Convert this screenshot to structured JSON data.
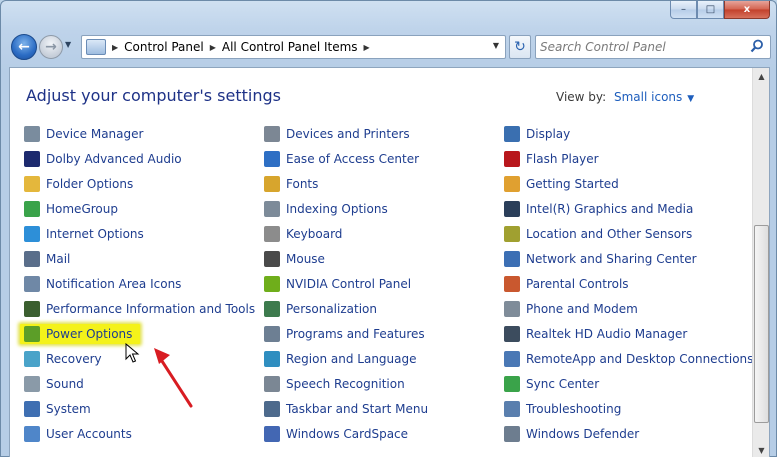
{
  "window": {
    "minimize_label": "–",
    "maximize_label": "□",
    "close_label": "x"
  },
  "nav": {
    "back_glyph": "←",
    "forward_glyph": "→",
    "refresh_glyph": "↻"
  },
  "address": {
    "crumbs": [
      "Control Panel",
      "All Control Panel Items"
    ]
  },
  "search": {
    "placeholder": "Search Control Panel"
  },
  "header": {
    "title": "Adjust your computer's settings",
    "view_by_label": "View by:",
    "view_mode": "Small icons"
  },
  "items": {
    "col1": [
      {
        "label": "Device Manager",
        "icon": "device-manager-icon",
        "color": "#7a8c9e"
      },
      {
        "label": "Dolby Advanced Audio",
        "icon": "dolby-icon",
        "color": "#1d2a6e"
      },
      {
        "label": "Folder Options",
        "icon": "folder-icon",
        "color": "#e4b73c"
      },
      {
        "label": "HomeGroup",
        "icon": "homegroup-icon",
        "color": "#3aa34a"
      },
      {
        "label": "Internet Options",
        "icon": "internet-icon",
        "color": "#2d8fd8"
      },
      {
        "label": "Mail",
        "icon": "mail-icon",
        "color": "#5a6e8a"
      },
      {
        "label": "Notification Area Icons",
        "icon": "notification-icon",
        "color": "#6f88a6"
      },
      {
        "label": "Performance Information and Tools",
        "icon": "performance-icon",
        "color": "#3b5f2f"
      },
      {
        "label": "Power Options",
        "icon": "power-icon",
        "color": "#5c9e28"
      },
      {
        "label": "Recovery",
        "icon": "recovery-icon",
        "color": "#4aa3c9"
      },
      {
        "label": "Sound",
        "icon": "sound-icon",
        "color": "#8a9aa8"
      },
      {
        "label": "System",
        "icon": "system-icon",
        "color": "#3f6fb2"
      },
      {
        "label": "User Accounts",
        "icon": "user-accounts-icon",
        "color": "#4f86c9"
      }
    ],
    "col2": [
      {
        "label": "Devices and Printers",
        "icon": "printer-icon",
        "color": "#7c8794"
      },
      {
        "label": "Ease of Access Center",
        "icon": "ease-of-access-icon",
        "color": "#2e6fc4"
      },
      {
        "label": "Fonts",
        "icon": "fonts-icon",
        "color": "#d7a52d"
      },
      {
        "label": "Indexing Options",
        "icon": "indexing-icon",
        "color": "#7d8b99"
      },
      {
        "label": "Keyboard",
        "icon": "keyboard-icon",
        "color": "#8c8c8c"
      },
      {
        "label": "Mouse",
        "icon": "mouse-icon",
        "color": "#4a4a4a"
      },
      {
        "label": "NVIDIA Control Panel",
        "icon": "nvidia-icon",
        "color": "#6fae1b"
      },
      {
        "label": "Personalization",
        "icon": "personalization-icon",
        "color": "#3d7b4d"
      },
      {
        "label": "Programs and Features",
        "icon": "programs-icon",
        "color": "#6d7f93"
      },
      {
        "label": "Region and Language",
        "icon": "region-icon",
        "color": "#2f8ec0"
      },
      {
        "label": "Speech Recognition",
        "icon": "microphone-icon",
        "color": "#7b8794"
      },
      {
        "label": "Taskbar and Start Menu",
        "icon": "taskbar-icon",
        "color": "#4d6a8c"
      },
      {
        "label": "Windows CardSpace",
        "icon": "cardspace-icon",
        "color": "#4367b3"
      }
    ],
    "col3": [
      {
        "label": "Display",
        "icon": "display-icon",
        "color": "#3a6fb0"
      },
      {
        "label": "Flash Player",
        "icon": "flash-icon",
        "color": "#b8171c"
      },
      {
        "label": "Getting Started",
        "icon": "getting-started-icon",
        "color": "#e0a030"
      },
      {
        "label": "Intel(R) Graphics and Media",
        "icon": "intel-icon",
        "color": "#2b3f5a"
      },
      {
        "label": "Location and Other Sensors",
        "icon": "location-icon",
        "color": "#a0a030"
      },
      {
        "label": "Network and Sharing Center",
        "icon": "network-icon",
        "color": "#3c6fb4"
      },
      {
        "label": "Parental Controls",
        "icon": "parental-controls-icon",
        "color": "#c9582f"
      },
      {
        "label": "Phone and Modem",
        "icon": "phone-icon",
        "color": "#7f8c99"
      },
      {
        "label": "Realtek HD Audio Manager",
        "icon": "realtek-icon",
        "color": "#3c4c5e"
      },
      {
        "label": "RemoteApp and Desktop Connections",
        "icon": "remoteapp-icon",
        "color": "#4a78b5"
      },
      {
        "label": "Sync Center",
        "icon": "sync-icon",
        "color": "#3aa34a"
      },
      {
        "label": "Troubleshooting",
        "icon": "troubleshooting-icon",
        "color": "#5a7fae"
      },
      {
        "label": "Windows Defender",
        "icon": "defender-icon",
        "color": "#6d7d8f"
      }
    ]
  },
  "highlight_color": "#f4f21a",
  "annotation_color": "#d81c22"
}
